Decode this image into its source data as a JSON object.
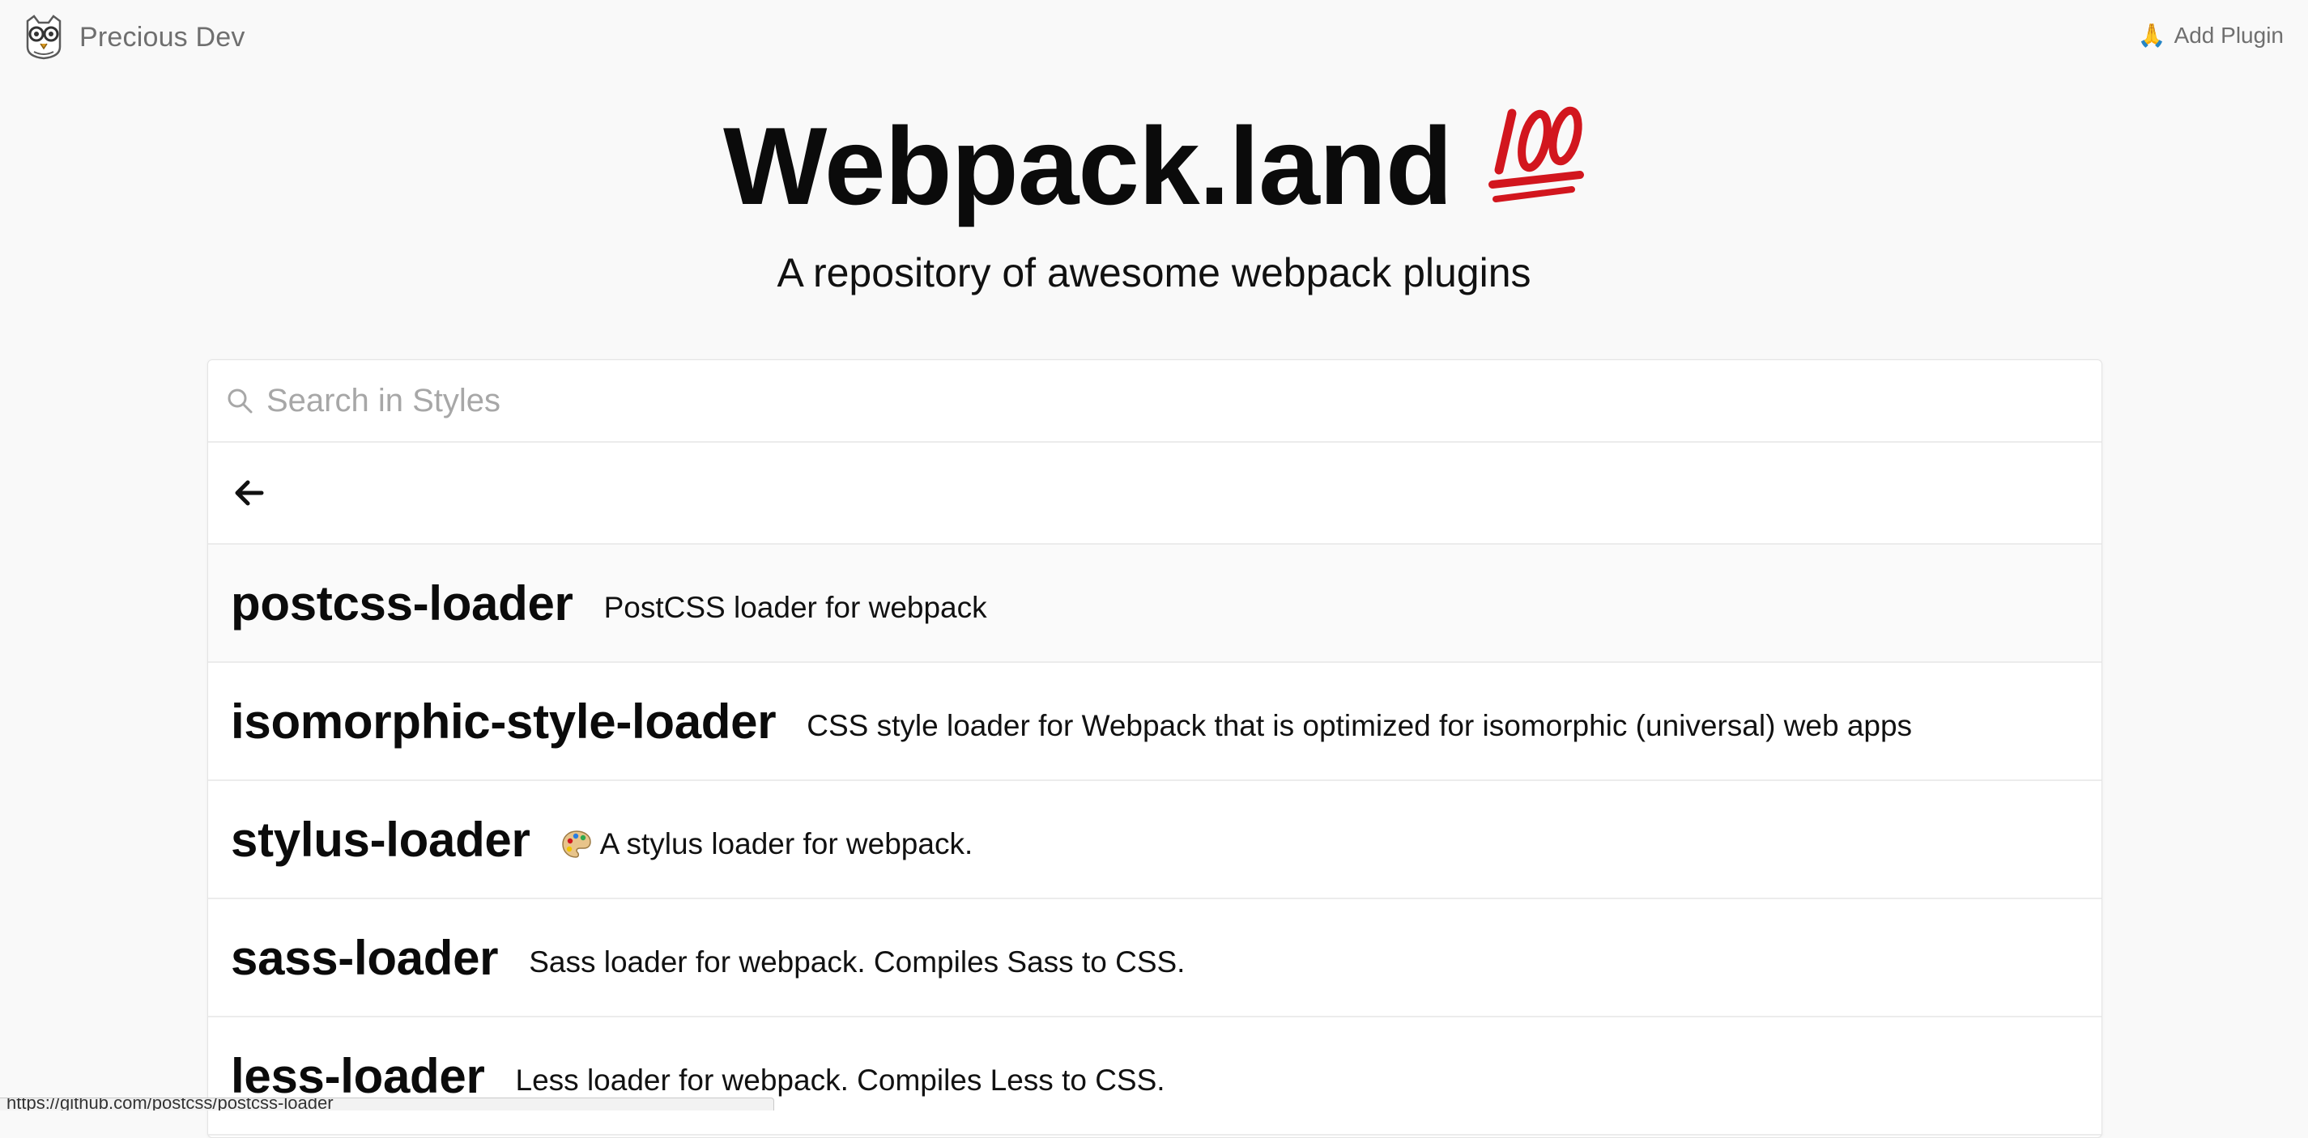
{
  "header": {
    "brand_name": "Precious Dev",
    "brand_logo_icon": "owl-glasses-icon",
    "add_plugin_label": "Add Plugin",
    "add_plugin_icon": "pray-hands-icon"
  },
  "hero": {
    "title": "Webpack.land",
    "title_icon": "hundred-points-icon",
    "subtitle": "A repository of awesome webpack plugins"
  },
  "search": {
    "placeholder": "Search in Styles",
    "value": ""
  },
  "navigation": {
    "back_icon": "arrow-left-icon"
  },
  "plugins": [
    {
      "name": "postcss-loader",
      "description": "PostCSS loader for webpack",
      "icon": ""
    },
    {
      "name": "isomorphic-style-loader",
      "description": "CSS style loader for Webpack that is optimized for isomorphic (universal) web apps",
      "icon": ""
    },
    {
      "name": "stylus-loader",
      "description": "A stylus loader for webpack.",
      "icon": "palette-icon"
    },
    {
      "name": "sass-loader",
      "description": "Sass loader for webpack. Compiles Sass to CSS.",
      "icon": ""
    },
    {
      "name": "less-loader",
      "description": "Less loader for webpack. Compiles Less to CSS.",
      "icon": ""
    }
  ],
  "status_bar": {
    "url": "https://github.com/postcss/postcss-loader"
  },
  "colors": {
    "background": "#f9f9f9",
    "panel": "#ffffff",
    "muted_text": "#6f6f6f",
    "hundred_red": "#d2161e",
    "placeholder": "#a7a7a7"
  }
}
